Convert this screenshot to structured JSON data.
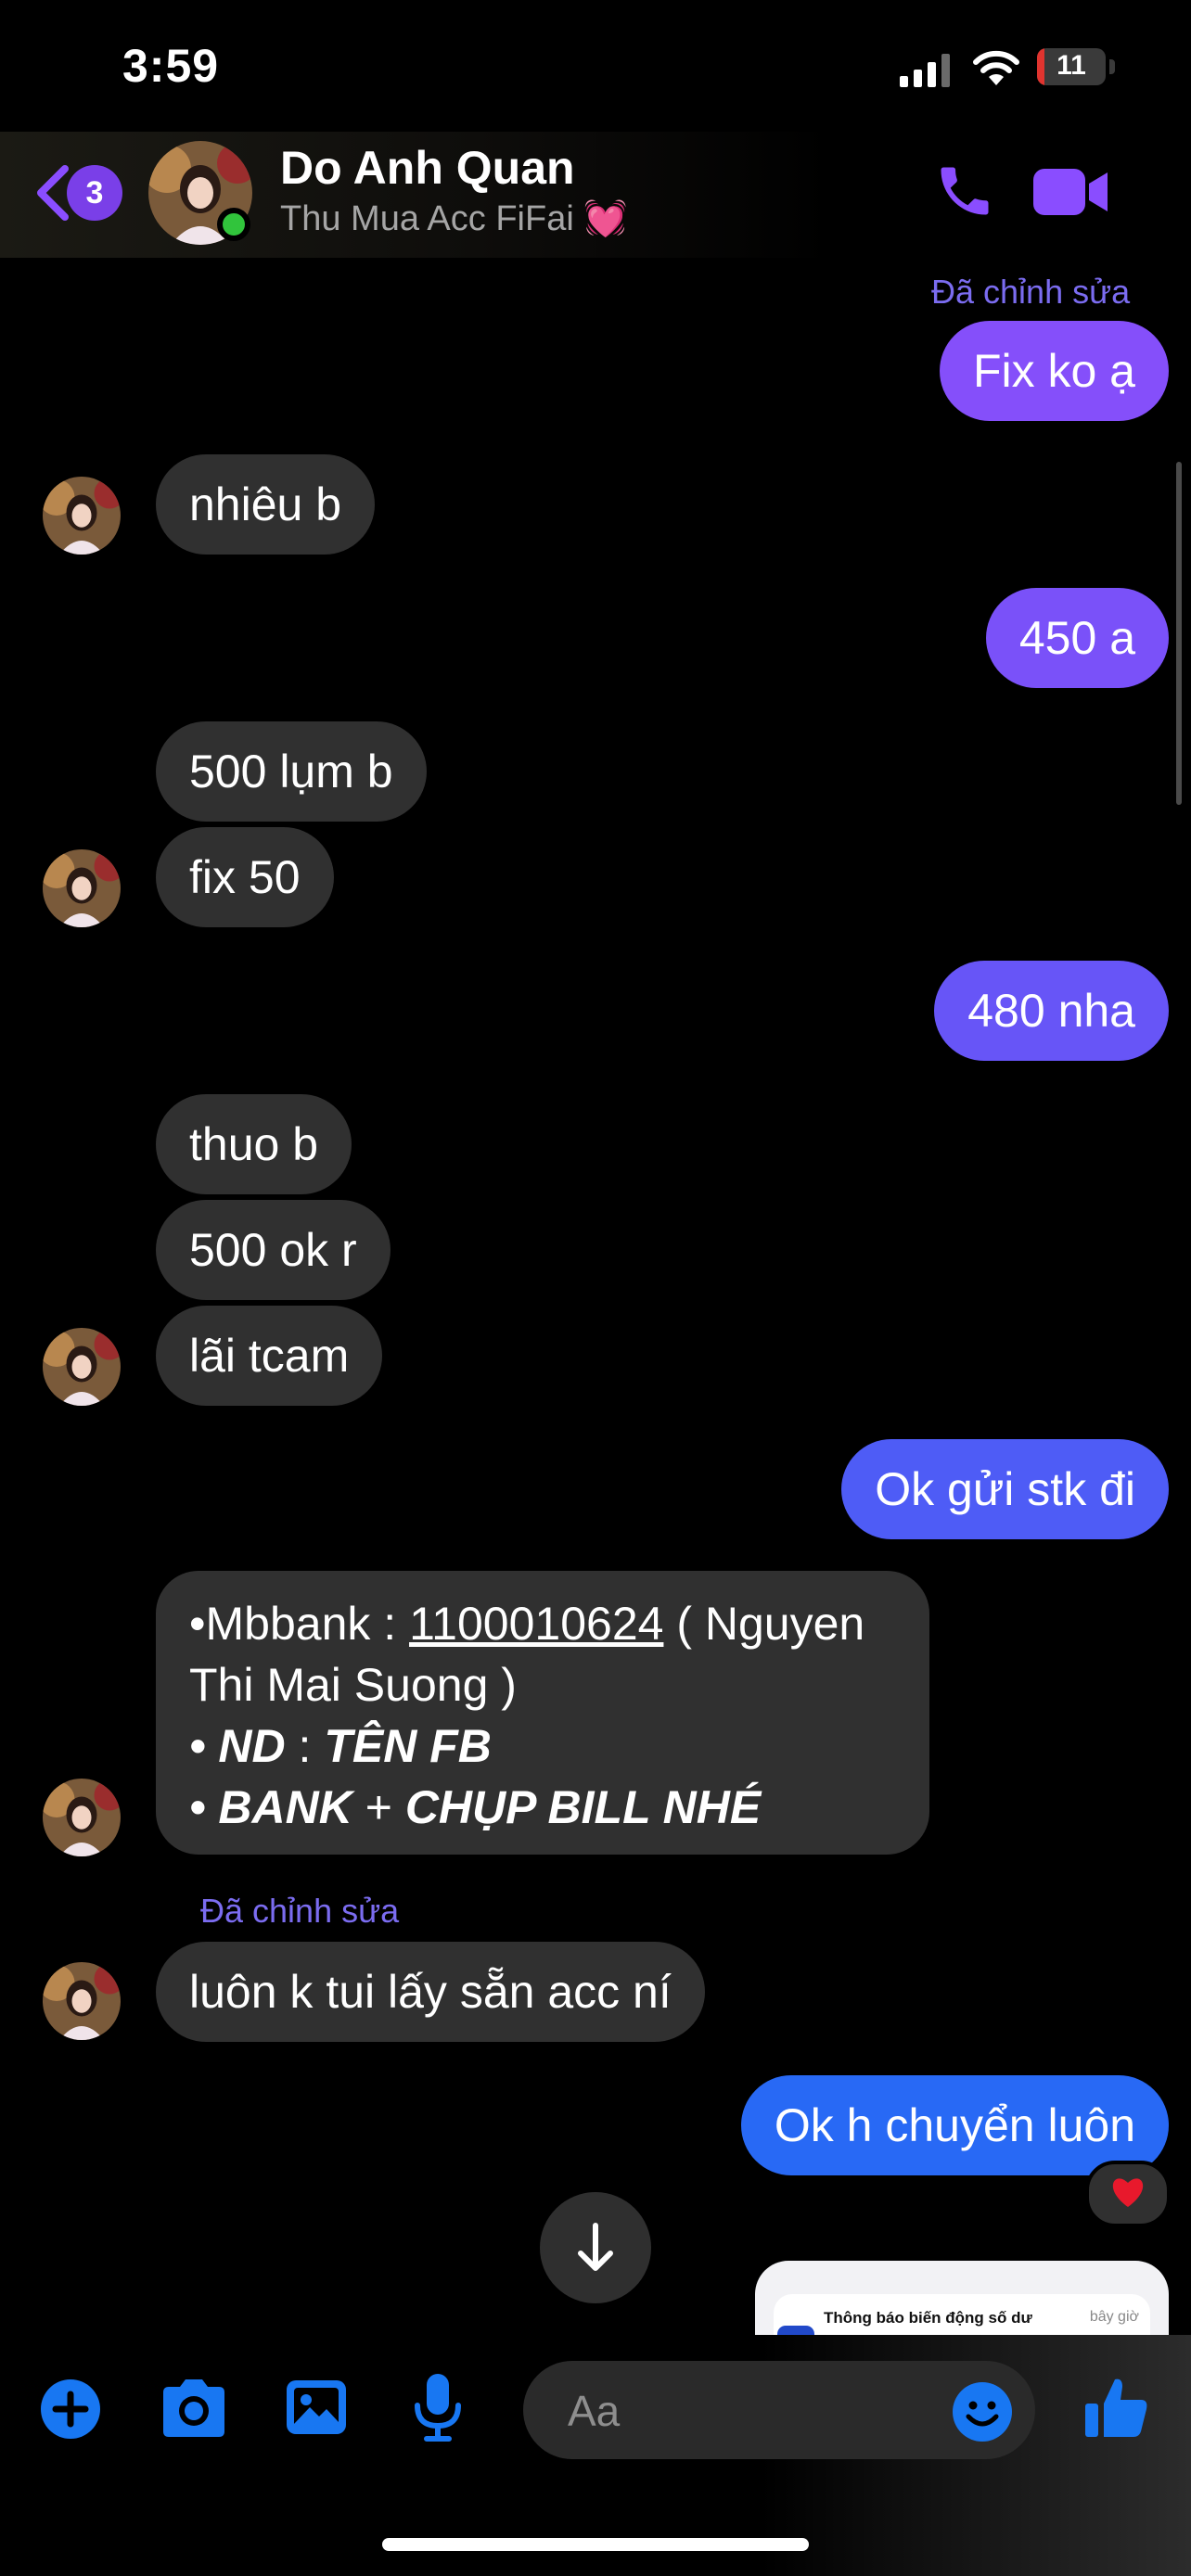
{
  "status_bar": {
    "time": "3:59",
    "battery": "11",
    "battery_level": 0.11
  },
  "header": {
    "back_count": "3",
    "name": "Do Anh Quan",
    "subtitle": "Thu Mua Acc FiFai 💓"
  },
  "messages": {
    "edited_label_1": "Đã chỉnh sửa",
    "m1": "Fix ko ạ",
    "m2": "nhiêu b",
    "m3": "450 a",
    "m4": "500 lụm b",
    "m5": "fix 50",
    "m6": "480 nha",
    "m7": "thuo b",
    "m8": "500 ok r",
    "m9": "lãi tcam",
    "m10": "Ok gửi stk đi",
    "bank": {
      "prefix": "•Mbbank : ",
      "account": "1100010624",
      "holder_a": " ( Nguyen",
      "holder_b": "Thi Mai Suong )",
      "nd_bullet": "• ",
      "nd_key": "ND",
      "nd_sep": " : ",
      "nd_value": "TÊN FB",
      "bank_bullet": "• ",
      "bank_a": "BANK",
      "bank_sep": " + ",
      "bank_b": "CHỤP BILL NHÉ"
    },
    "edited_label_2": "Đã chỉnh sửa",
    "m11": "luôn k tui lấy sẵn acc ní",
    "m12": "Ok h chuyển luôn",
    "reaction": "❤️",
    "preview_title": "Thông báo biến động số dư",
    "preview_time": "bây giờ"
  },
  "composer": {
    "placeholder": "Aa"
  },
  "colors": {
    "accent": "#8a4dff",
    "out_top": "#8f4dfb",
    "out_mid": "#5b57f6",
    "out_bottom": "#1b6ef5",
    "in_bubble": "#303030",
    "toolbar_blue": "#1877f2"
  }
}
